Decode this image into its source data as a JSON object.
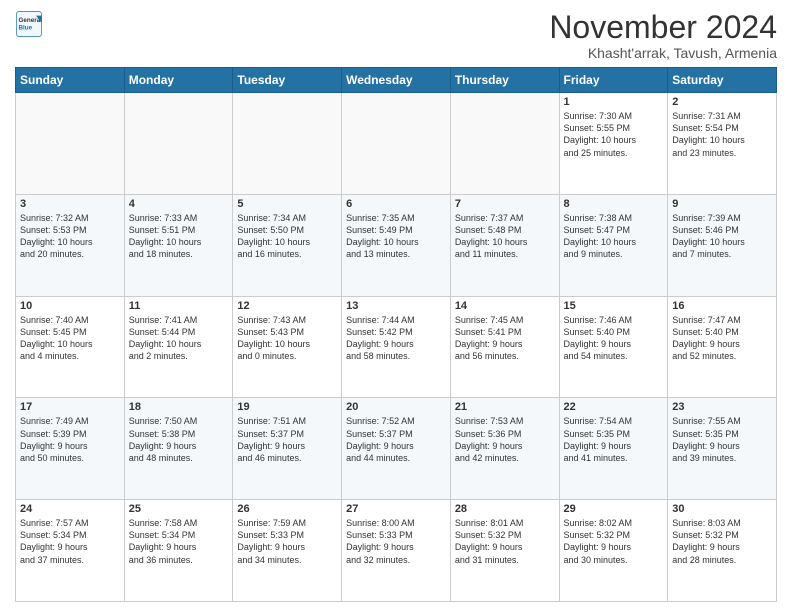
{
  "logo": {
    "general": "General",
    "blue": "Blue"
  },
  "title": "November 2024",
  "location": "Khasht'arrak, Tavush, Armenia",
  "days_header": [
    "Sunday",
    "Monday",
    "Tuesday",
    "Wednesday",
    "Thursday",
    "Friday",
    "Saturday"
  ],
  "weeks": [
    [
      {
        "day": "",
        "info": ""
      },
      {
        "day": "",
        "info": ""
      },
      {
        "day": "",
        "info": ""
      },
      {
        "day": "",
        "info": ""
      },
      {
        "day": "",
        "info": ""
      },
      {
        "day": "1",
        "info": "Sunrise: 7:30 AM\nSunset: 5:55 PM\nDaylight: 10 hours\nand 25 minutes."
      },
      {
        "day": "2",
        "info": "Sunrise: 7:31 AM\nSunset: 5:54 PM\nDaylight: 10 hours\nand 23 minutes."
      }
    ],
    [
      {
        "day": "3",
        "info": "Sunrise: 7:32 AM\nSunset: 5:53 PM\nDaylight: 10 hours\nand 20 minutes."
      },
      {
        "day": "4",
        "info": "Sunrise: 7:33 AM\nSunset: 5:51 PM\nDaylight: 10 hours\nand 18 minutes."
      },
      {
        "day": "5",
        "info": "Sunrise: 7:34 AM\nSunset: 5:50 PM\nDaylight: 10 hours\nand 16 minutes."
      },
      {
        "day": "6",
        "info": "Sunrise: 7:35 AM\nSunset: 5:49 PM\nDaylight: 10 hours\nand 13 minutes."
      },
      {
        "day": "7",
        "info": "Sunrise: 7:37 AM\nSunset: 5:48 PM\nDaylight: 10 hours\nand 11 minutes."
      },
      {
        "day": "8",
        "info": "Sunrise: 7:38 AM\nSunset: 5:47 PM\nDaylight: 10 hours\nand 9 minutes."
      },
      {
        "day": "9",
        "info": "Sunrise: 7:39 AM\nSunset: 5:46 PM\nDaylight: 10 hours\nand 7 minutes."
      }
    ],
    [
      {
        "day": "10",
        "info": "Sunrise: 7:40 AM\nSunset: 5:45 PM\nDaylight: 10 hours\nand 4 minutes."
      },
      {
        "day": "11",
        "info": "Sunrise: 7:41 AM\nSunset: 5:44 PM\nDaylight: 10 hours\nand 2 minutes."
      },
      {
        "day": "12",
        "info": "Sunrise: 7:43 AM\nSunset: 5:43 PM\nDaylight: 10 hours\nand 0 minutes."
      },
      {
        "day": "13",
        "info": "Sunrise: 7:44 AM\nSunset: 5:42 PM\nDaylight: 9 hours\nand 58 minutes."
      },
      {
        "day": "14",
        "info": "Sunrise: 7:45 AM\nSunset: 5:41 PM\nDaylight: 9 hours\nand 56 minutes."
      },
      {
        "day": "15",
        "info": "Sunrise: 7:46 AM\nSunset: 5:40 PM\nDaylight: 9 hours\nand 54 minutes."
      },
      {
        "day": "16",
        "info": "Sunrise: 7:47 AM\nSunset: 5:40 PM\nDaylight: 9 hours\nand 52 minutes."
      }
    ],
    [
      {
        "day": "17",
        "info": "Sunrise: 7:49 AM\nSunset: 5:39 PM\nDaylight: 9 hours\nand 50 minutes."
      },
      {
        "day": "18",
        "info": "Sunrise: 7:50 AM\nSunset: 5:38 PM\nDaylight: 9 hours\nand 48 minutes."
      },
      {
        "day": "19",
        "info": "Sunrise: 7:51 AM\nSunset: 5:37 PM\nDaylight: 9 hours\nand 46 minutes."
      },
      {
        "day": "20",
        "info": "Sunrise: 7:52 AM\nSunset: 5:37 PM\nDaylight: 9 hours\nand 44 minutes."
      },
      {
        "day": "21",
        "info": "Sunrise: 7:53 AM\nSunset: 5:36 PM\nDaylight: 9 hours\nand 42 minutes."
      },
      {
        "day": "22",
        "info": "Sunrise: 7:54 AM\nSunset: 5:35 PM\nDaylight: 9 hours\nand 41 minutes."
      },
      {
        "day": "23",
        "info": "Sunrise: 7:55 AM\nSunset: 5:35 PM\nDaylight: 9 hours\nand 39 minutes."
      }
    ],
    [
      {
        "day": "24",
        "info": "Sunrise: 7:57 AM\nSunset: 5:34 PM\nDaylight: 9 hours\nand 37 minutes."
      },
      {
        "day": "25",
        "info": "Sunrise: 7:58 AM\nSunset: 5:34 PM\nDaylight: 9 hours\nand 36 minutes."
      },
      {
        "day": "26",
        "info": "Sunrise: 7:59 AM\nSunset: 5:33 PM\nDaylight: 9 hours\nand 34 minutes."
      },
      {
        "day": "27",
        "info": "Sunrise: 8:00 AM\nSunset: 5:33 PM\nDaylight: 9 hours\nand 32 minutes."
      },
      {
        "day": "28",
        "info": "Sunrise: 8:01 AM\nSunset: 5:32 PM\nDaylight: 9 hours\nand 31 minutes."
      },
      {
        "day": "29",
        "info": "Sunrise: 8:02 AM\nSunset: 5:32 PM\nDaylight: 9 hours\nand 30 minutes."
      },
      {
        "day": "30",
        "info": "Sunrise: 8:03 AM\nSunset: 5:32 PM\nDaylight: 9 hours\nand 28 minutes."
      }
    ]
  ]
}
